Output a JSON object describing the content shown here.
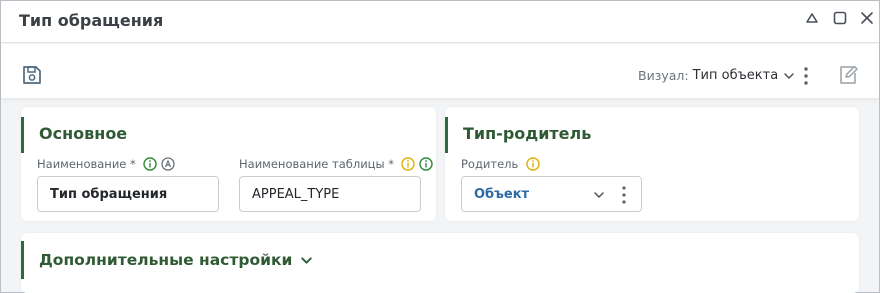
{
  "window": {
    "title": "Тип обращения",
    "controls": [
      "collapse-icon",
      "maximize-icon",
      "close-icon"
    ]
  },
  "toolbar": {
    "visual_label": "Визуал:",
    "visual_value": "Тип объекта"
  },
  "main_section": {
    "title": "Основное",
    "name_field": {
      "label": "Наименование *",
      "value": "Тип обращения",
      "icons": [
        "info-icon",
        "autotranslate-icon"
      ]
    },
    "table_field": {
      "label": "Наименование таблицы *",
      "value": "APPEAL_TYPE",
      "icons": [
        "warning-info-icon",
        "info-icon"
      ]
    }
  },
  "parent_section": {
    "title": "Тип-родитель",
    "parent_field": {
      "label": "Родитель",
      "value": "Объект",
      "icons": [
        "warning-info-icon"
      ]
    }
  },
  "extra_section": {
    "title": "Дополнительные настройки"
  },
  "colors": {
    "accent_green": "#2f6b3a",
    "section_title": "#2f5a34",
    "link_blue": "#2e6ba6",
    "info_green": "#2e8b3a",
    "warning_yellow": "#e0b100"
  }
}
